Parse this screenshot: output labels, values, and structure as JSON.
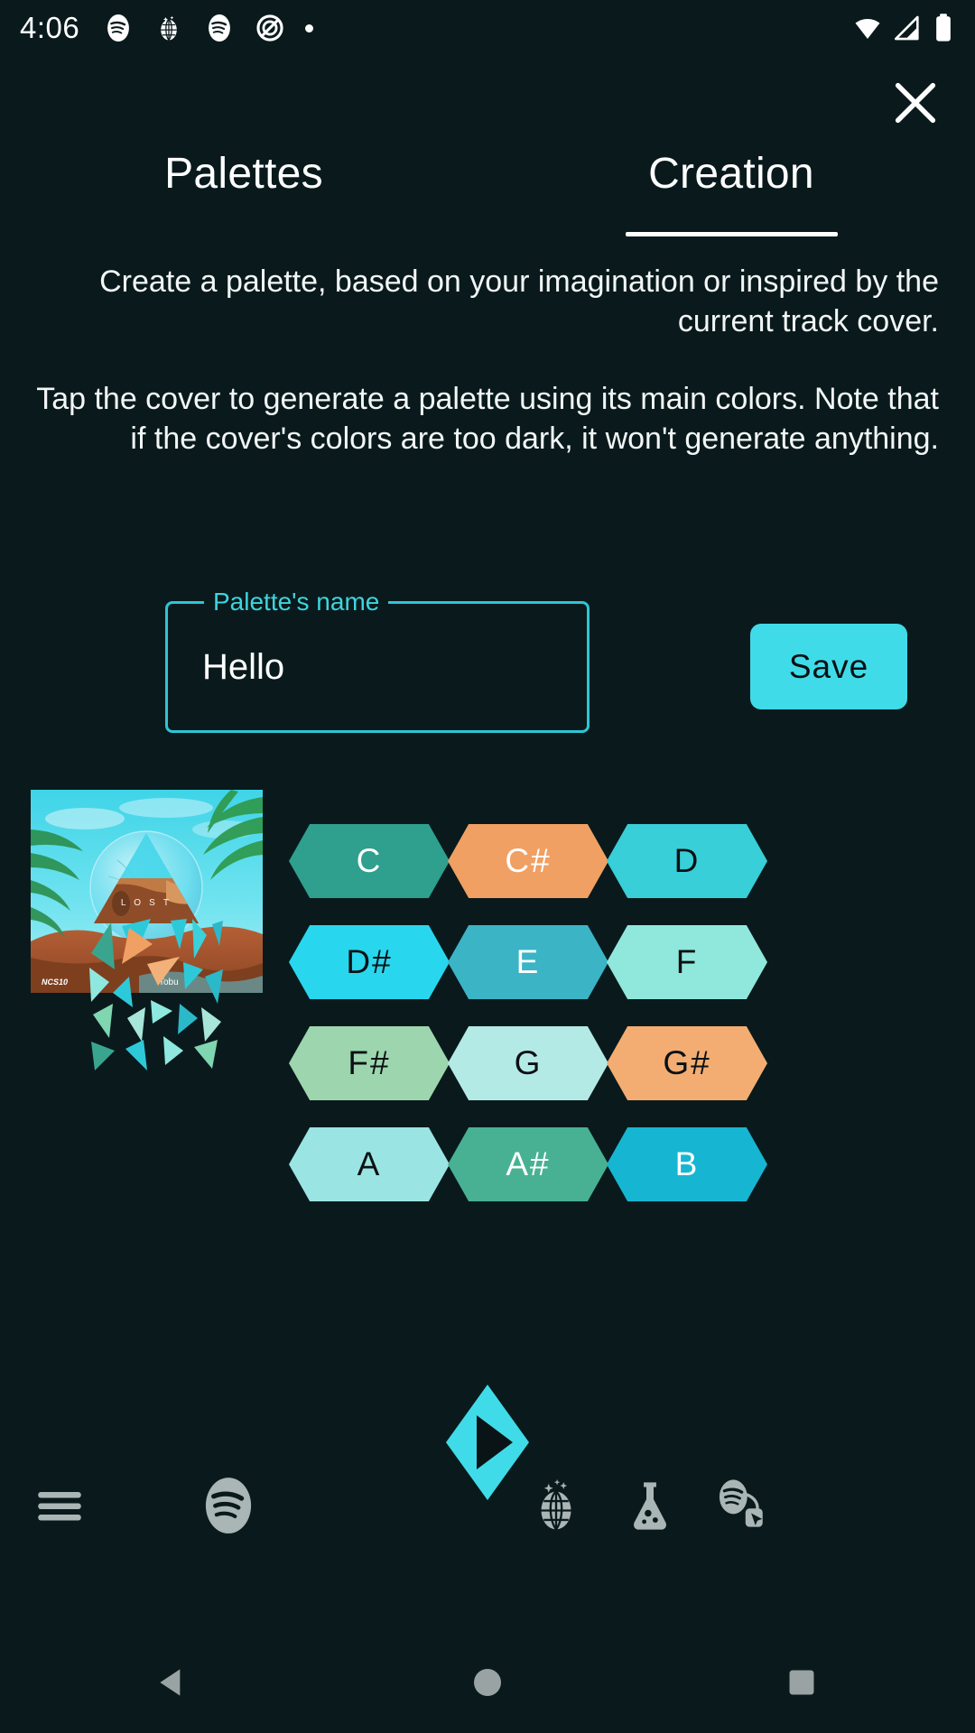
{
  "status_bar": {
    "time": "4:06",
    "left_icons": [
      "spotify-icon",
      "disco-ball-icon",
      "spotify-icon",
      "no-entry-icon",
      "dot-icon"
    ],
    "right_icons": [
      "wifi-icon",
      "cellular-signal-icon",
      "battery-icon"
    ]
  },
  "header": {
    "close_label": "close-icon"
  },
  "tabs": [
    {
      "label": "Palettes",
      "active": false
    },
    {
      "label": "Creation",
      "active": true
    }
  ],
  "description": {
    "paragraph_1": "Create a palette, based on your imagination or inspired by the current track cover.",
    "paragraph_2": "Tap the cover to generate a palette using its main colors. Note that if the cover's colors are too dark, it won't generate anything."
  },
  "form": {
    "name_label": "Palette's name",
    "name_value": "Hello",
    "name_placeholder": "Palette's name",
    "save_label": "Save",
    "accent_color": "#40dbe8",
    "outline_color": "#2ec5d4"
  },
  "album_cover": {
    "title": "LOST",
    "artist": "Tobu",
    "label": "NCS10"
  },
  "palette_preview": {
    "colors": [
      "#3aa58f",
      "#2ec9d8",
      "#f0a063",
      "#8fe8e0",
      "#7fd6b0",
      "#2bb8c8",
      "#a8e6d8",
      "#f2b179"
    ]
  },
  "notes": [
    {
      "name": "C",
      "color": "#2f9f8e",
      "text_color": "#ffffff"
    },
    {
      "name": "C#",
      "color": "#f0a063",
      "text_color": "#ffffff"
    },
    {
      "name": "D",
      "color": "#38cfd8",
      "text_color": "#0b1114"
    },
    {
      "name": "D#",
      "color": "#28d7ee",
      "text_color": "#0b1114"
    },
    {
      "name": "E",
      "color": "#3bb4c6",
      "text_color": "#ffffff"
    },
    {
      "name": "F",
      "color": "#90e8dd",
      "text_color": "#0b1114"
    },
    {
      "name": "F#",
      "color": "#9dd6ae",
      "text_color": "#0b1114"
    },
    {
      "name": "G",
      "color": "#b4eae6",
      "text_color": "#0b1114"
    },
    {
      "name": "G#",
      "color": "#f3ad72",
      "text_color": "#0b1114"
    },
    {
      "name": "A",
      "color": "#9ae5e3",
      "text_color": "#0b1114"
    },
    {
      "name": "A#",
      "color": "#48b193",
      "text_color": "#ffffff"
    },
    {
      "name": "B",
      "color": "#16b6d2",
      "text_color": "#ffffff"
    }
  ],
  "bottom_nav": {
    "items": [
      {
        "icon": "hamburger-menu-icon"
      },
      {
        "icon": "spotify-icon"
      },
      {
        "icon": "disco-ball-icon"
      },
      {
        "icon": "flask-icon"
      },
      {
        "icon": "spotify-cursor-icon"
      }
    ],
    "play_button": {
      "icon": "play-icon",
      "color": "#40dbe8"
    }
  },
  "android_nav": {
    "back": "back-triangle-icon",
    "home": "home-circle-icon",
    "recents": "recents-square-icon"
  }
}
